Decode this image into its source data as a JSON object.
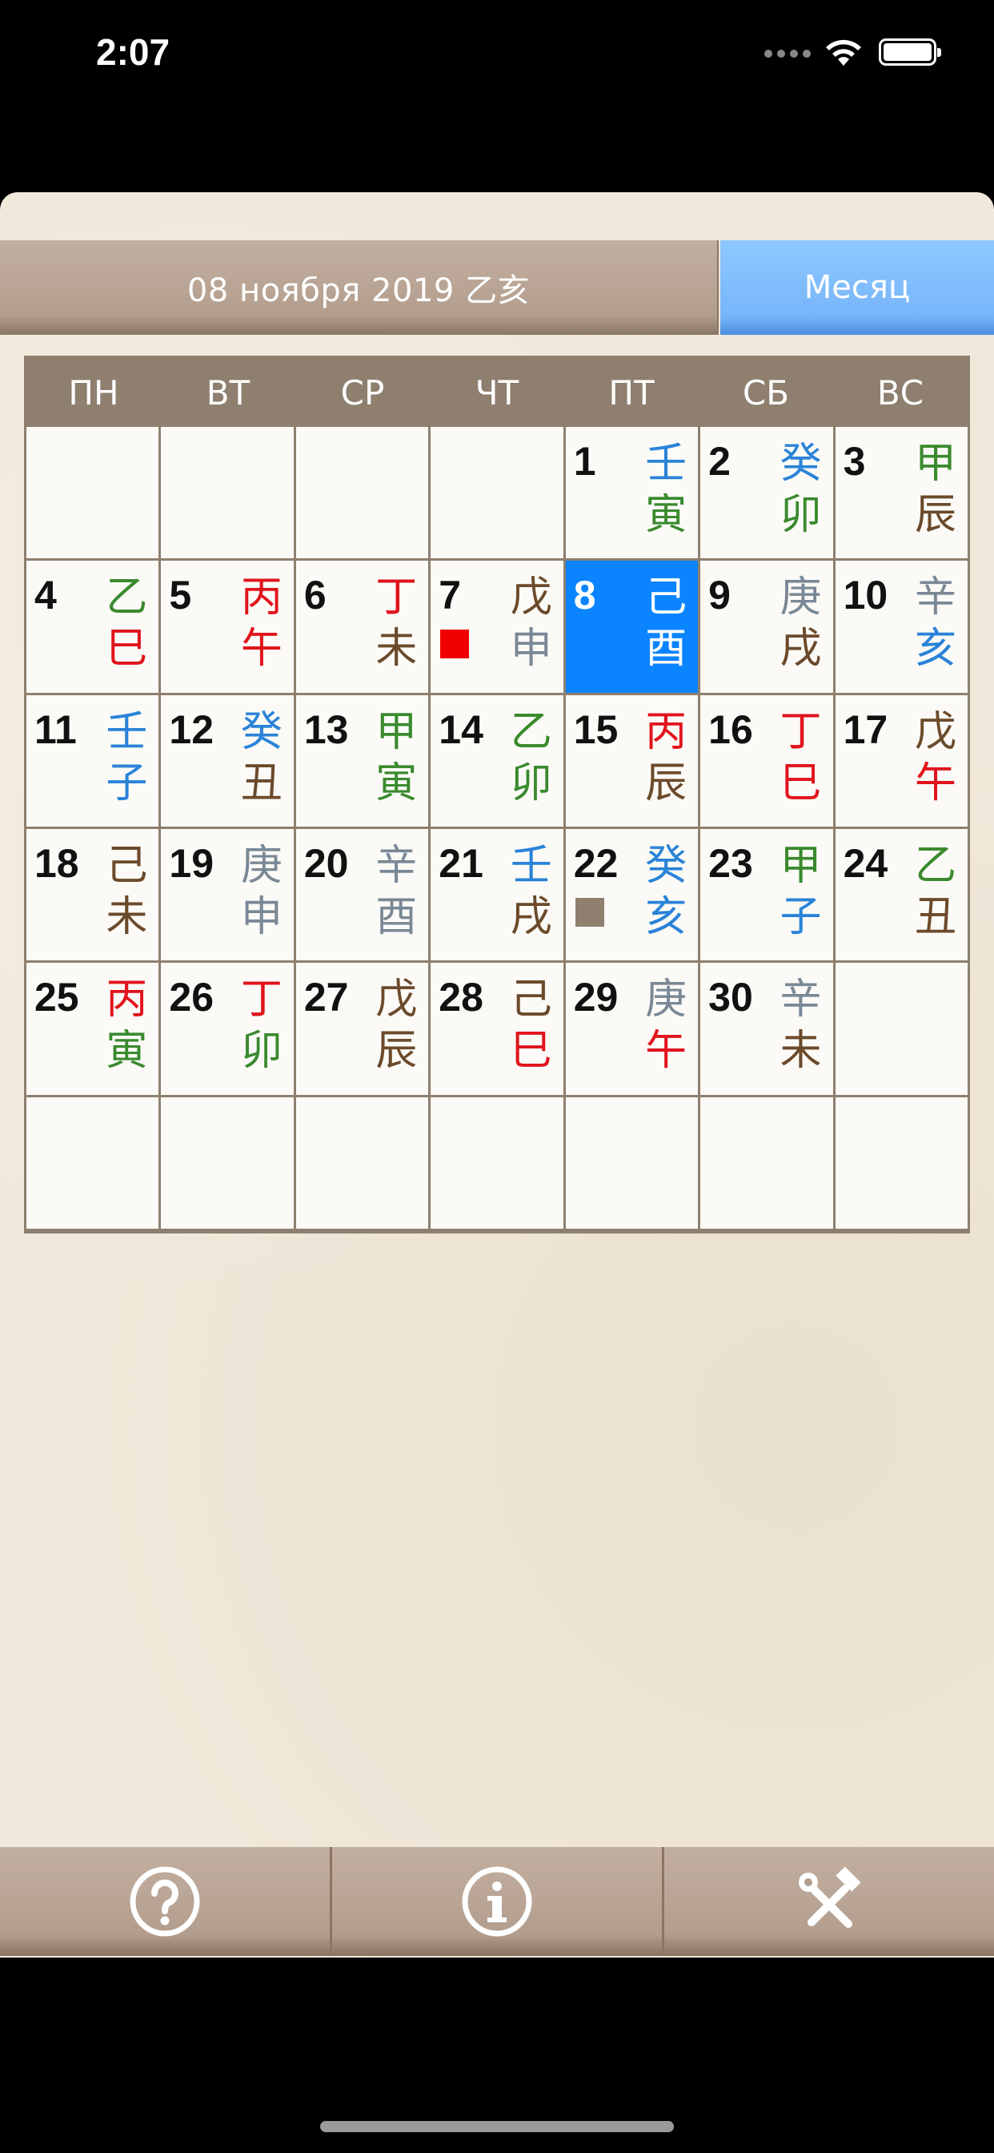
{
  "status_bar": {
    "time": "2:07"
  },
  "header": {
    "date_label": "08 ноября 2019 乙亥",
    "view_button_label": "Месяц"
  },
  "calendar": {
    "weekdays": [
      "ПН",
      "ВТ",
      "СР",
      "ЧТ",
      "ПТ",
      "СБ",
      "ВС"
    ],
    "selected_day": "8",
    "cells": [
      {
        "day": "",
        "stem": "",
        "branch": "",
        "sc": "",
        "bc": ""
      },
      {
        "day": "",
        "stem": "",
        "branch": "",
        "sc": "",
        "bc": ""
      },
      {
        "day": "",
        "stem": "",
        "branch": "",
        "sc": "",
        "bc": ""
      },
      {
        "day": "",
        "stem": "",
        "branch": "",
        "sc": "",
        "bc": ""
      },
      {
        "day": "1",
        "stem": "壬",
        "branch": "寅",
        "sc": "#2a83d8",
        "bc": "#3a8a2e"
      },
      {
        "day": "2",
        "stem": "癸",
        "branch": "卯",
        "sc": "#2a83d8",
        "bc": "#3a8a2e"
      },
      {
        "day": "3",
        "stem": "甲",
        "branch": "辰",
        "sc": "#3a8a2e",
        "bc": "#6b4a2b"
      },
      {
        "day": "4",
        "stem": "乙",
        "branch": "巳",
        "sc": "#3a8a2e",
        "bc": "#e0141c"
      },
      {
        "day": "5",
        "stem": "丙",
        "branch": "午",
        "sc": "#e0141c",
        "bc": "#e0141c"
      },
      {
        "day": "6",
        "stem": "丁",
        "branch": "未",
        "sc": "#e0141c",
        "bc": "#6b4a2b"
      },
      {
        "day": "7",
        "stem": "戊",
        "branch": "申",
        "sc": "#6b4a2b",
        "bc": "#7a8896",
        "mark": "#f00000"
      },
      {
        "day": "8",
        "stem": "己",
        "branch": "酉",
        "sc": "#ffffff",
        "bc": "#ffffff"
      },
      {
        "day": "9",
        "stem": "庚",
        "branch": "戌",
        "sc": "#7a8896",
        "bc": "#6b4a2b"
      },
      {
        "day": "10",
        "stem": "辛",
        "branch": "亥",
        "sc": "#7a8896",
        "bc": "#2a83d8"
      },
      {
        "day": "11",
        "stem": "壬",
        "branch": "子",
        "sc": "#2a83d8",
        "bc": "#2a83d8"
      },
      {
        "day": "12",
        "stem": "癸",
        "branch": "丑",
        "sc": "#2a83d8",
        "bc": "#6b4a2b"
      },
      {
        "day": "13",
        "stem": "甲",
        "branch": "寅",
        "sc": "#3a8a2e",
        "bc": "#3a8a2e"
      },
      {
        "day": "14",
        "stem": "乙",
        "branch": "卯",
        "sc": "#3a8a2e",
        "bc": "#3a8a2e"
      },
      {
        "day": "15",
        "stem": "丙",
        "branch": "辰",
        "sc": "#e0141c",
        "bc": "#6b4a2b"
      },
      {
        "day": "16",
        "stem": "丁",
        "branch": "巳",
        "sc": "#e0141c",
        "bc": "#e0141c"
      },
      {
        "day": "17",
        "stem": "戊",
        "branch": "午",
        "sc": "#6b4a2b",
        "bc": "#e0141c"
      },
      {
        "day": "18",
        "stem": "己",
        "branch": "未",
        "sc": "#6b4a2b",
        "bc": "#6b4a2b"
      },
      {
        "day": "19",
        "stem": "庚",
        "branch": "申",
        "sc": "#7a8896",
        "bc": "#7a8896"
      },
      {
        "day": "20",
        "stem": "辛",
        "branch": "酉",
        "sc": "#7a8896",
        "bc": "#7a8896"
      },
      {
        "day": "21",
        "stem": "壬",
        "branch": "戌",
        "sc": "#2a83d8",
        "bc": "#6b4a2b"
      },
      {
        "day": "22",
        "stem": "癸",
        "branch": "亥",
        "sc": "#2a83d8",
        "bc": "#2a83d8",
        "mark": "#8e7f6f"
      },
      {
        "day": "23",
        "stem": "甲",
        "branch": "子",
        "sc": "#3a8a2e",
        "bc": "#2a83d8"
      },
      {
        "day": "24",
        "stem": "乙",
        "branch": "丑",
        "sc": "#3a8a2e",
        "bc": "#6b4a2b"
      },
      {
        "day": "25",
        "stem": "丙",
        "branch": "寅",
        "sc": "#e0141c",
        "bc": "#3a8a2e"
      },
      {
        "day": "26",
        "stem": "丁",
        "branch": "卯",
        "sc": "#e0141c",
        "bc": "#3a8a2e"
      },
      {
        "day": "27",
        "stem": "戊",
        "branch": "辰",
        "sc": "#6b4a2b",
        "bc": "#6b4a2b"
      },
      {
        "day": "28",
        "stem": "己",
        "branch": "巳",
        "sc": "#6b4a2b",
        "bc": "#e0141c"
      },
      {
        "day": "29",
        "stem": "庚",
        "branch": "午",
        "sc": "#7a8896",
        "bc": "#e0141c"
      },
      {
        "day": "30",
        "stem": "辛",
        "branch": "未",
        "sc": "#7a8896",
        "bc": "#6b4a2b"
      },
      {
        "day": "",
        "stem": "",
        "branch": "",
        "sc": "",
        "bc": ""
      },
      {
        "day": "",
        "stem": "",
        "branch": "",
        "sc": "",
        "bc": ""
      },
      {
        "day": "",
        "stem": "",
        "branch": "",
        "sc": "",
        "bc": ""
      },
      {
        "day": "",
        "stem": "",
        "branch": "",
        "sc": "",
        "bc": ""
      },
      {
        "day": "",
        "stem": "",
        "branch": "",
        "sc": "",
        "bc": ""
      },
      {
        "day": "",
        "stem": "",
        "branch": "",
        "sc": "",
        "bc": ""
      },
      {
        "day": "",
        "stem": "",
        "branch": "",
        "sc": "",
        "bc": ""
      },
      {
        "day": "",
        "stem": "",
        "branch": "",
        "sc": "",
        "bc": ""
      }
    ]
  },
  "toolbar": {
    "buttons": [
      "help-icon",
      "info-icon",
      "tools-icon"
    ]
  },
  "colors": {
    "accent_blue": "#0a84ff",
    "header_brown": "#8e7f6f",
    "month_button_blue": "#78b6fb"
  }
}
